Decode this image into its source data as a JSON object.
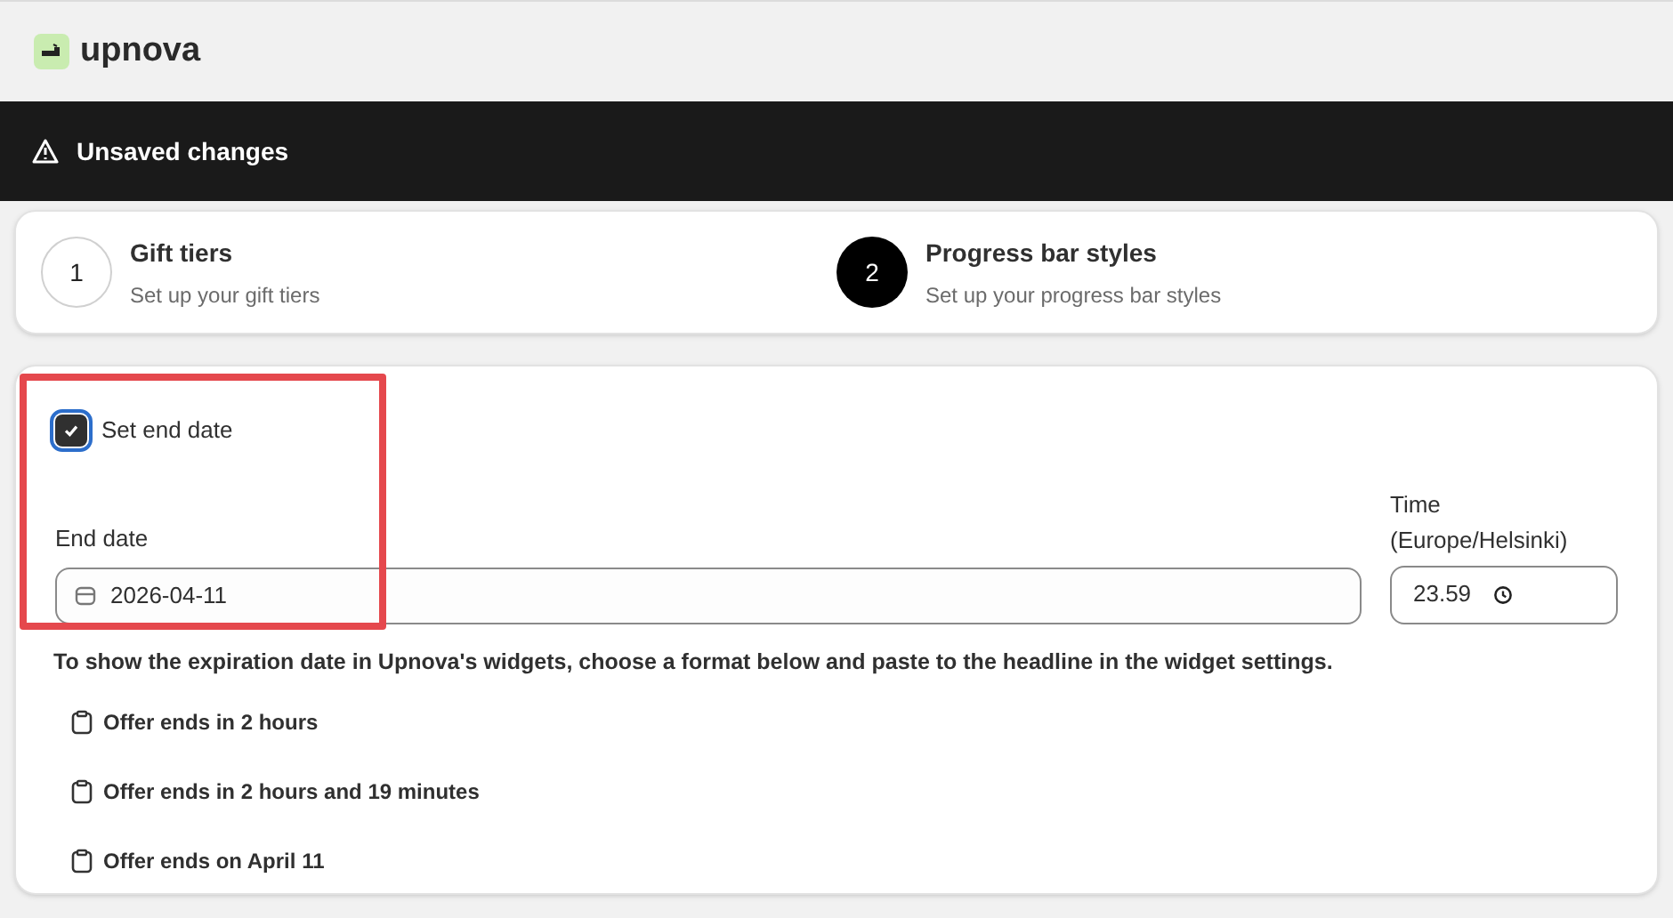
{
  "app": {
    "name": "upnova"
  },
  "notice": {
    "text": "Unsaved changes"
  },
  "steps": [
    {
      "number": "1",
      "title": "Gift tiers",
      "subtitle": "Set up your gift tiers",
      "selected": false
    },
    {
      "number": "2",
      "title": "Progress bar styles",
      "subtitle": "Set up your progress bar styles",
      "selected": true
    }
  ],
  "end_date": {
    "checkbox_label": "Set end date",
    "checked": true,
    "date_label": "End date",
    "date_value": "2026-04-11",
    "time_label": "Time (Europe/Helsinki)",
    "time_value": "23.59"
  },
  "help_text": "To show the expiration date in Upnova's widgets, choose a format below and paste to the headline in the widget settings.",
  "formats": [
    "Offer ends in 2 hours",
    "Offer ends in 2 hours and 19 minutes",
    "Offer ends on April 11"
  ]
}
